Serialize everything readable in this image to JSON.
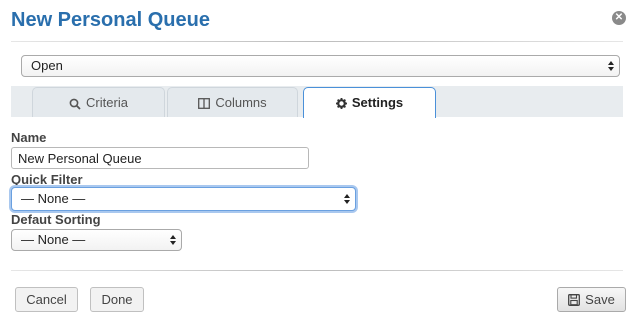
{
  "dialog": {
    "title": "New Personal Queue",
    "close_icon": "close-circle-icon"
  },
  "status_select": {
    "value": "Open"
  },
  "tabs": [
    {
      "label": "Criteria",
      "icon": "search-icon",
      "active": false
    },
    {
      "label": "Columns",
      "icon": "columns-icon",
      "active": false
    },
    {
      "label": "Settings",
      "icon": "gear-icon",
      "active": true
    }
  ],
  "form": {
    "name_label": "Name",
    "name_value": "New Personal Queue",
    "quick_filter_label": "Quick Filter",
    "quick_filter_value": "— None —",
    "default_sorting_label": "Defaut Sorting",
    "default_sorting_value": "— None —"
  },
  "footer": {
    "cancel_label": "Cancel",
    "done_label": "Done",
    "save_label": "Save",
    "save_icon": "floppy-disk-icon"
  },
  "colors": {
    "title": "#2a6fad",
    "active_tab_border": "#4a90d9",
    "focus_ring": "#a9c8ef"
  }
}
